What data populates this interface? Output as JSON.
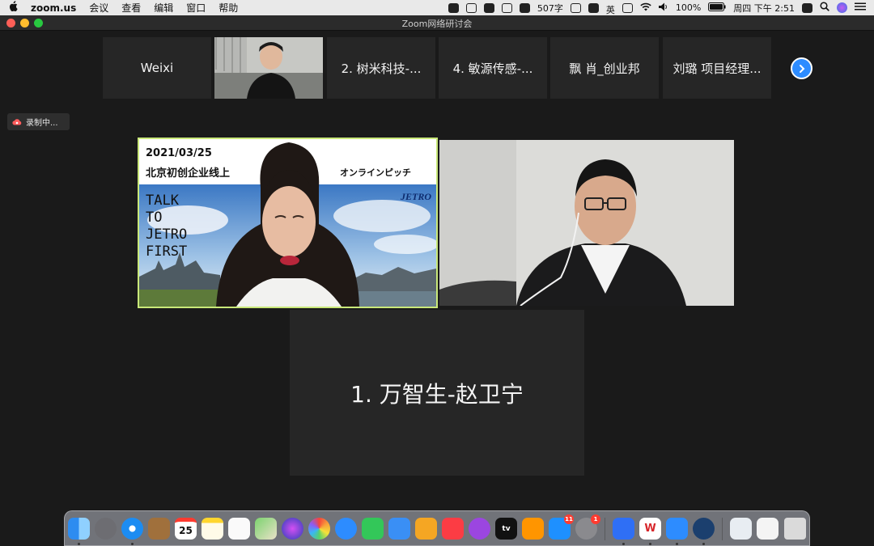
{
  "menubar": {
    "app_name": "zoom.us",
    "menus": [
      "会议",
      "查看",
      "编辑",
      "窗口",
      "帮助"
    ],
    "word_count": "507字",
    "input_method": "英",
    "battery": "100%",
    "clock": "周四 下午 2:51"
  },
  "window": {
    "title": "Zoom网络研讨会"
  },
  "gallery": {
    "tiles": [
      "Weixi",
      "",
      "2. 树米科技-...",
      "4. 敏源传感-...",
      "飘 肖_创业邦",
      "刘璐 项目经理..."
    ]
  },
  "recording": {
    "label": "录制中..."
  },
  "speaker_slide": {
    "date": "2021/03/25",
    "title": "北京初创企业线上",
    "title_tail": "オンラインピッチ",
    "brand": "JETRO",
    "tagline": [
      "TALK",
      "TO",
      "JETRO",
      "FIRST"
    ]
  },
  "participant_name": "1. 万智生-赵卫宁",
  "dock": {
    "calendar_day": "25",
    "appstore_badge": "11",
    "settings_badge": "1",
    "tv_label": "tv"
  },
  "colors": {
    "accent": "#2d8cff",
    "speaker_border": "#c9e879",
    "tile_bg": "#262626",
    "window_bg": "#1a1a1a"
  }
}
